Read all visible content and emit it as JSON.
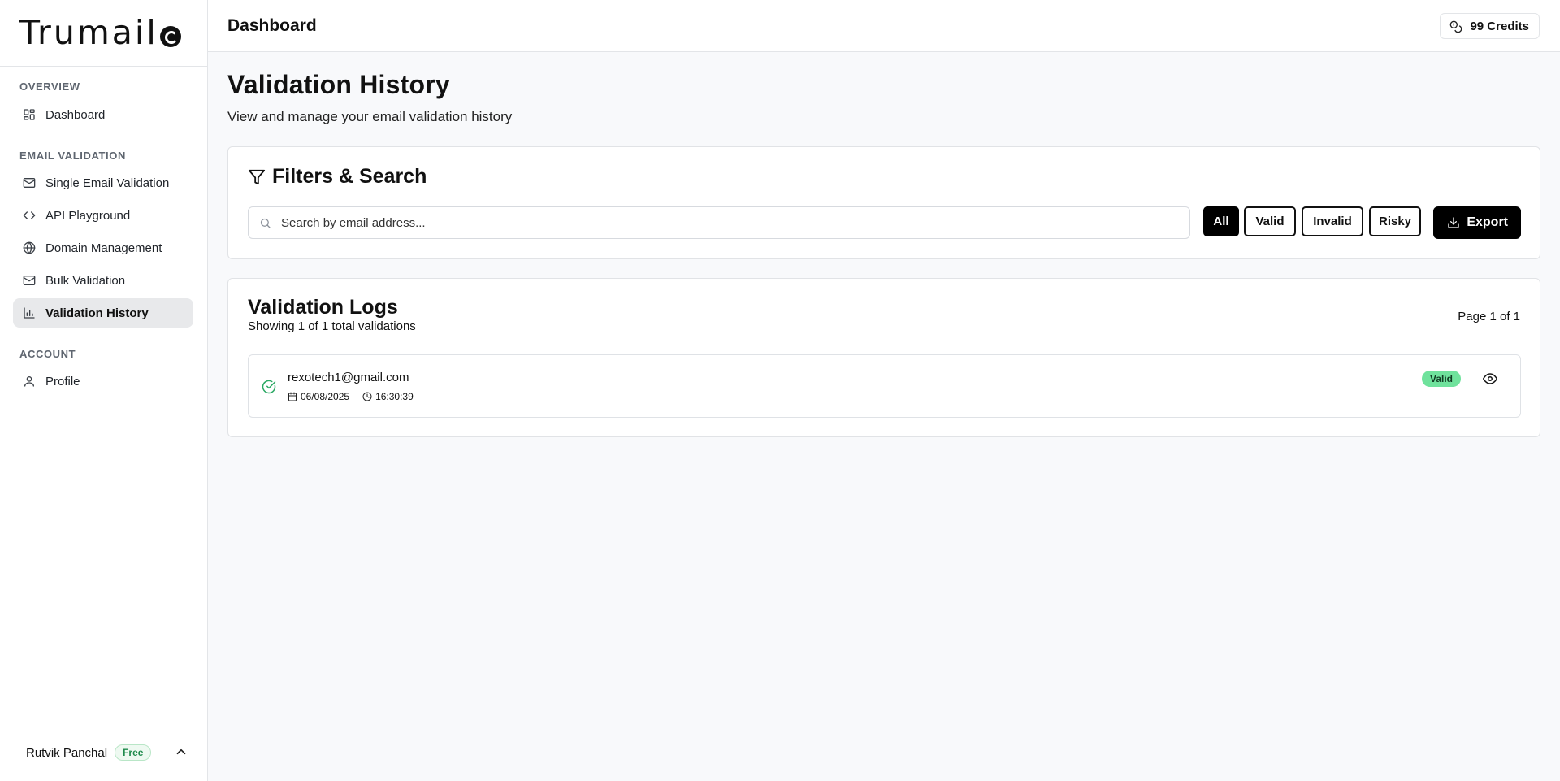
{
  "app": {
    "logo_text": "Trumail",
    "header_title": "Dashboard",
    "credits": "99 Credits"
  },
  "sidebar": {
    "sections": [
      {
        "label": "OVERVIEW"
      },
      {
        "label": "EMAIL VALIDATION"
      },
      {
        "label": "ACCOUNT"
      }
    ],
    "items": [
      {
        "label": "Dashboard",
        "icon": "grid-icon"
      },
      {
        "label": "Single Email Validation",
        "icon": "mail-icon"
      },
      {
        "label": "API Playground",
        "icon": "code-icon"
      },
      {
        "label": "Domain Management",
        "icon": "globe-icon"
      },
      {
        "label": "Bulk Validation",
        "icon": "mail-icon"
      },
      {
        "label": "Validation History",
        "icon": "bar-chart-icon",
        "active": true
      },
      {
        "label": "Profile",
        "icon": "user-icon"
      }
    ],
    "user": {
      "name": "Rutvik Panchal",
      "plan": "Free"
    }
  },
  "main": {
    "title": "Validation History",
    "subtitle": "View and manage your email validation history",
    "filters": {
      "title": "Filters & Search",
      "search_placeholder": "Search by email address...",
      "chips": [
        "All",
        "Valid",
        "Invalid",
        "Risky"
      ],
      "active_chip": "All",
      "export_label": "Export"
    },
    "logs": {
      "title": "Validation Logs",
      "summary": "Showing 1 of 1 total validations",
      "page_info": "Page 1 of 1",
      "rows": [
        {
          "email": "rexotech1@gmail.com",
          "date": "06/08/2025",
          "time": "16:30:39",
          "status": "Valid"
        }
      ]
    }
  },
  "colors": {
    "accent": "#000000",
    "valid_badge": "#6fe29c",
    "valid_icon": "#2aa863",
    "plan_badge": "#1f8a4c"
  }
}
